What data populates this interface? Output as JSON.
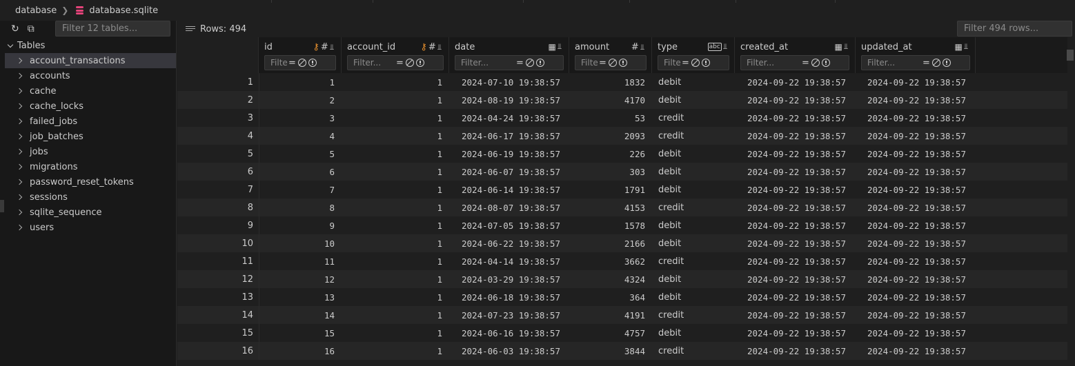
{
  "breadcrumb": {
    "folder": "database",
    "file": "database.sqlite"
  },
  "sidebar": {
    "filter_placeholder": "Filter 12 tables...",
    "root_label": "Tables",
    "items": [
      "account_transactions",
      "accounts",
      "cache",
      "cache_locks",
      "failed_jobs",
      "job_batches",
      "jobs",
      "migrations",
      "password_reset_tokens",
      "sessions",
      "sqlite_sequence",
      "users"
    ],
    "selected_index": 0
  },
  "main": {
    "rows_label": "Rows: 494",
    "filter_placeholder": "Filter 494 rows..."
  },
  "columns": [
    {
      "name": "id",
      "placeholder": "Filte"
    },
    {
      "name": "account_id",
      "placeholder": "Filter..."
    },
    {
      "name": "date",
      "placeholder": "Filter..."
    },
    {
      "name": "amount",
      "placeholder": "Filte"
    },
    {
      "name": "type",
      "placeholder": "Filte"
    },
    {
      "name": "created_at",
      "placeholder": "Filter..."
    },
    {
      "name": "updated_at",
      "placeholder": "Filter..."
    }
  ],
  "rows": [
    [
      "1",
      "1",
      "1",
      "2024-07-10 19:38:57",
      "1832",
      "debit",
      "2024-09-22 19:38:57",
      "2024-09-22 19:38:57"
    ],
    [
      "2",
      "2",
      "1",
      "2024-08-19 19:38:57",
      "4170",
      "debit",
      "2024-09-22 19:38:57",
      "2024-09-22 19:38:57"
    ],
    [
      "3",
      "3",
      "1",
      "2024-04-24 19:38:57",
      "53",
      "credit",
      "2024-09-22 19:38:57",
      "2024-09-22 19:38:57"
    ],
    [
      "4",
      "4",
      "1",
      "2024-06-17 19:38:57",
      "2093",
      "credit",
      "2024-09-22 19:38:57",
      "2024-09-22 19:38:57"
    ],
    [
      "5",
      "5",
      "1",
      "2024-06-19 19:38:57",
      "226",
      "debit",
      "2024-09-22 19:38:57",
      "2024-09-22 19:38:57"
    ],
    [
      "6",
      "6",
      "1",
      "2024-06-07 19:38:57",
      "303",
      "debit",
      "2024-09-22 19:38:57",
      "2024-09-22 19:38:57"
    ],
    [
      "7",
      "7",
      "1",
      "2024-06-14 19:38:57",
      "1791",
      "debit",
      "2024-09-22 19:38:57",
      "2024-09-22 19:38:57"
    ],
    [
      "8",
      "8",
      "1",
      "2024-08-07 19:38:57",
      "4153",
      "credit",
      "2024-09-22 19:38:57",
      "2024-09-22 19:38:57"
    ],
    [
      "9",
      "9",
      "1",
      "2024-07-05 19:38:57",
      "1578",
      "debit",
      "2024-09-22 19:38:57",
      "2024-09-22 19:38:57"
    ],
    [
      "10",
      "10",
      "1",
      "2024-06-22 19:38:57",
      "2166",
      "debit",
      "2024-09-22 19:38:57",
      "2024-09-22 19:38:57"
    ],
    [
      "11",
      "11",
      "1",
      "2024-04-14 19:38:57",
      "3662",
      "credit",
      "2024-09-22 19:38:57",
      "2024-09-22 19:38:57"
    ],
    [
      "12",
      "12",
      "1",
      "2024-03-29 19:38:57",
      "4324",
      "debit",
      "2024-09-22 19:38:57",
      "2024-09-22 19:38:57"
    ],
    [
      "13",
      "13",
      "1",
      "2024-06-18 19:38:57",
      "364",
      "debit",
      "2024-09-22 19:38:57",
      "2024-09-22 19:38:57"
    ],
    [
      "14",
      "14",
      "1",
      "2024-07-23 19:38:57",
      "4191",
      "credit",
      "2024-09-22 19:38:57",
      "2024-09-22 19:38:57"
    ],
    [
      "15",
      "15",
      "1",
      "2024-06-16 19:38:57",
      "4757",
      "debit",
      "2024-09-22 19:38:57",
      "2024-09-22 19:38:57"
    ],
    [
      "16",
      "16",
      "1",
      "2024-06-03 19:38:57",
      "3844",
      "credit",
      "2024-09-22 19:38:57",
      "2024-09-22 19:38:57"
    ]
  ],
  "icons": {
    "pk_icon": "key-icon",
    "numeric_icon": "hash-icon",
    "date_icon": "calendar-icon",
    "text_icon": "abc-icon",
    "pin_icon": "pin-icon"
  },
  "colors": {
    "accent_key": "#e8902e",
    "db_icon": "#e5437a"
  }
}
